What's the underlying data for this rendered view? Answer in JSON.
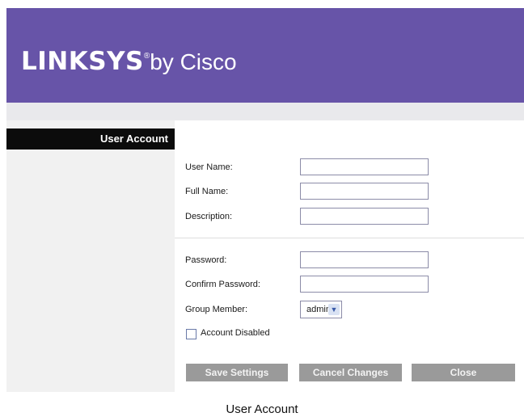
{
  "header": {
    "brand": "LINKSYS",
    "registered_mark": "®",
    "suffix": "by Cisco"
  },
  "sidebar": {
    "title": "User Account"
  },
  "form": {
    "user_name_label": "User Name:",
    "full_name_label": "Full Name:",
    "description_label": "Description:",
    "password_label": "Password:",
    "confirm_password_label": "Confirm Password:",
    "group_member_label": "Group Member:",
    "group_member_value": "admin",
    "account_disabled_label": "Account Disabled"
  },
  "buttons": {
    "save": "Save Settings",
    "cancel": "Cancel Changes",
    "close": "Close"
  },
  "caption": "User Account",
  "colors": {
    "header_bg": "#6754a8",
    "sidebar_title_bg": "#0c0c0c",
    "button_bg": "#9a9a9a"
  }
}
